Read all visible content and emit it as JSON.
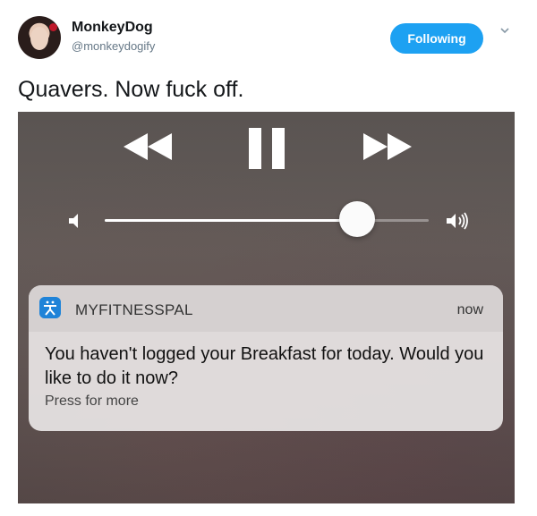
{
  "tweet": {
    "display_name": "MonkeyDog",
    "handle": "@monkeydogify",
    "follow_label": "Following",
    "text": "Quavers. Now fuck off."
  },
  "player": {
    "volume_level": 0.78
  },
  "notification": {
    "app_name": "MYFITNESSPAL",
    "time": "now",
    "message": "You haven't logged your Breakfast for today. Would you like to do it now?",
    "hint": "Press for more"
  },
  "colors": {
    "follow_button": "#1da1f2",
    "app_icon": "#1f83d8"
  }
}
